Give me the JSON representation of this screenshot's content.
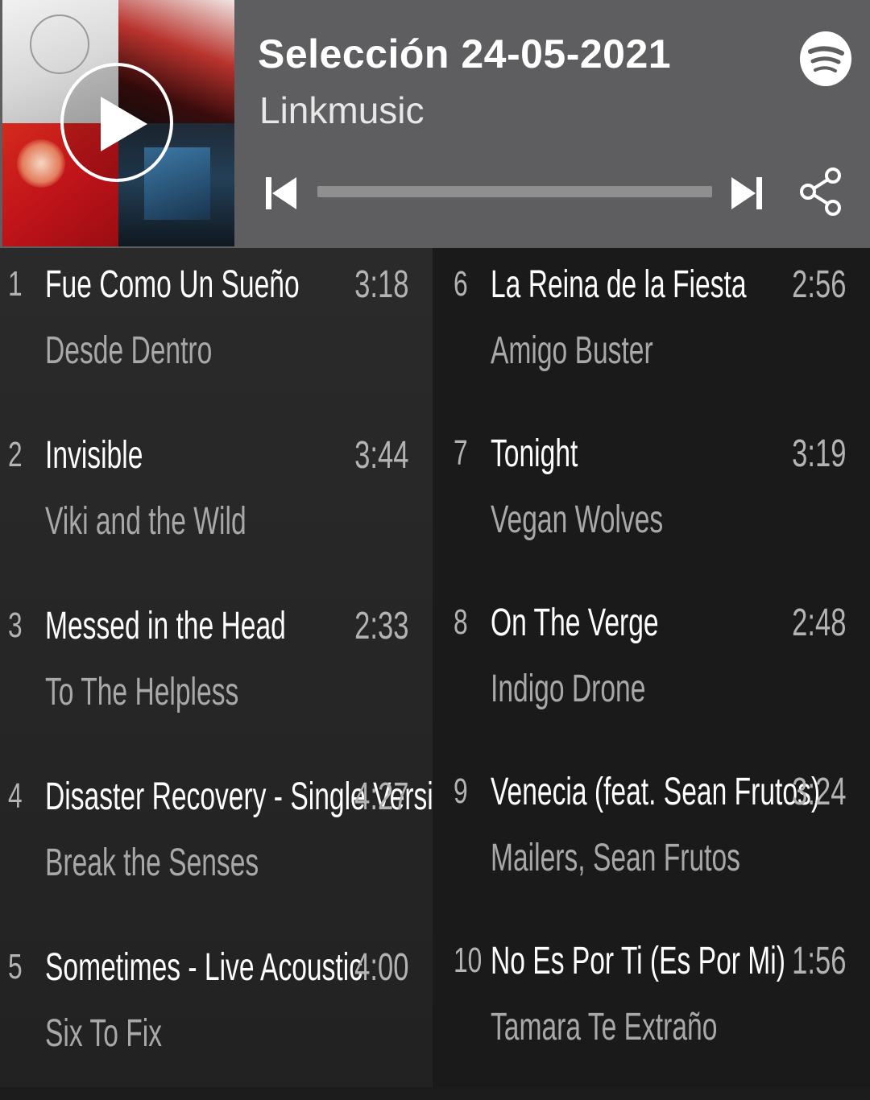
{
  "header": {
    "title": "Selección 24-05-2021",
    "subtitle": "Linkmusic",
    "progress_fraction": 0,
    "colors": {
      "header_bg": "#5e5e60",
      "progress_track": "#8f8f8f",
      "text": "#ffffff"
    },
    "icons": [
      "play-icon",
      "spotify-logo-icon",
      "previous-track-icon",
      "next-track-icon",
      "share-icon"
    ]
  },
  "tracks": [
    {
      "num": "1",
      "song": "Fue Como Un Sueño",
      "artist": "Desde Dentro",
      "duration": "3:18"
    },
    {
      "num": "2",
      "song": "Invisible",
      "artist": "Viki and the Wild",
      "duration": "3:44"
    },
    {
      "num": "3",
      "song": "Messed in the Head",
      "artist": "To The Helpless",
      "duration": "2:33"
    },
    {
      "num": "4",
      "song": "Disaster Recovery - Single Versi...",
      "artist": "Break the Senses",
      "duration": "4:27"
    },
    {
      "num": "5",
      "song": "Sometimes - Live Acoustic",
      "artist": "Six To Fix",
      "duration": "4:00"
    },
    {
      "num": "6",
      "song": "La Reina de la Fiesta",
      "artist": "Amigo Buster",
      "duration": "2:56"
    },
    {
      "num": "7",
      "song": "Tonight",
      "artist": "Vegan Wolves",
      "duration": "3:19"
    },
    {
      "num": "8",
      "song": "On The Verge",
      "artist": "Indigo Drone",
      "duration": "2:48"
    },
    {
      "num": "9",
      "song": "Venecia (feat. Sean Frutos)",
      "artist": "Mailers, Sean Frutos",
      "duration": "3:24"
    },
    {
      "num": "10",
      "song": "No Es Por Ti (Es Por Mi)",
      "artist": "Tamara Te Extraño",
      "duration": "1:56"
    }
  ]
}
